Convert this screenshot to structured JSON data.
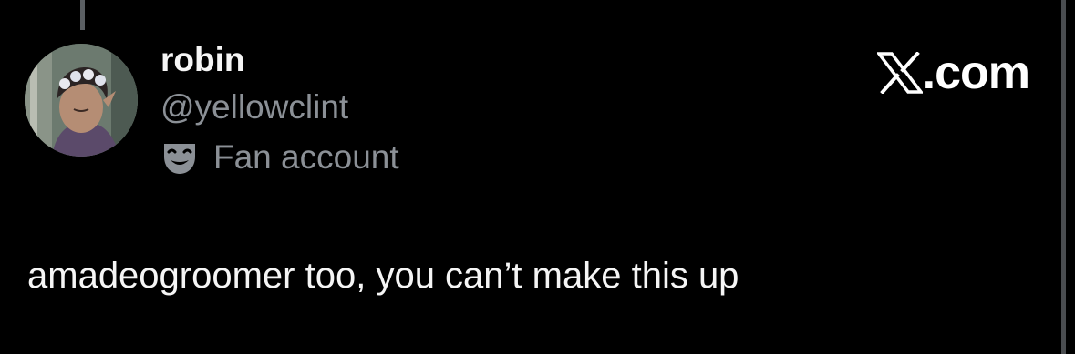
{
  "post": {
    "display_name": "robin",
    "handle": "@yellowclint",
    "account_label": "Fan account",
    "account_label_icon": "theater-mask-icon",
    "text": "amadeogroomer too, you can’t make this up"
  },
  "brand": {
    "logo_icon": "x-logo-icon",
    "domain_suffix": ".com"
  },
  "colors": {
    "background": "#000000",
    "primary_text": "#f5f5f5",
    "secondary_text": "#8b9096",
    "thread_line": "#5b5f63"
  }
}
